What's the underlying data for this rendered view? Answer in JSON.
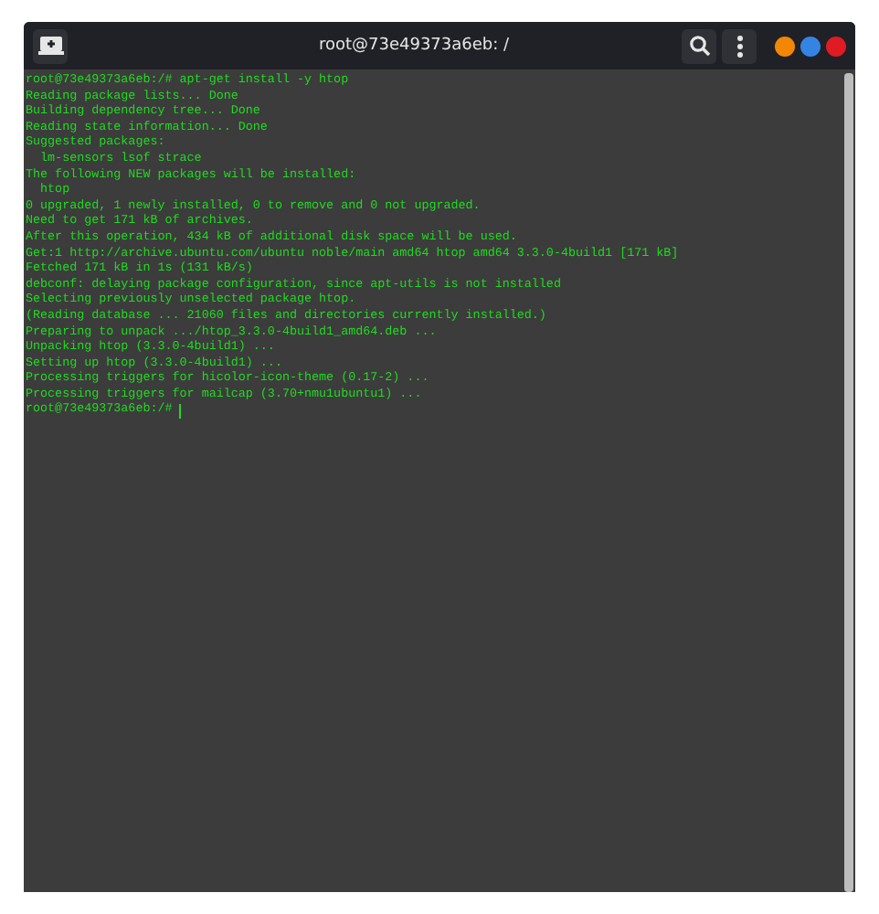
{
  "window": {
    "title": "root@73e49373a6eb: /"
  },
  "terminal": {
    "lines": [
      "root@73e49373a6eb:/# apt-get install -y htop",
      "Reading package lists... Done",
      "Building dependency tree... Done",
      "Reading state information... Done",
      "Suggested packages:",
      "  lm-sensors lsof strace",
      "The following NEW packages will be installed:",
      "  htop",
      "0 upgraded, 1 newly installed, 0 to remove and 0 not upgraded.",
      "Need to get 171 kB of archives.",
      "After this operation, 434 kB of additional disk space will be used.",
      "Get:1 http://archive.ubuntu.com/ubuntu noble/main amd64 htop amd64 3.3.0-4build1 [171 kB]",
      "Fetched 171 kB in 1s (131 kB/s)",
      "debconf: delaying package configuration, since apt-utils is not installed",
      "Selecting previously unselected package htop.",
      "(Reading database ... 21060 files and directories currently installed.)",
      "Preparing to unpack .../htop_3.3.0-4build1_amd64.deb ...",
      "Unpacking htop (3.3.0-4build1) ...",
      "Setting up htop (3.3.0-4build1) ...",
      "Processing triggers for hicolor-icon-theme (0.17-2) ...",
      "Processing triggers for mailcap (3.70+nmu1ubuntu1) ..."
    ],
    "prompt": "root@73e49373a6eb:/#"
  }
}
